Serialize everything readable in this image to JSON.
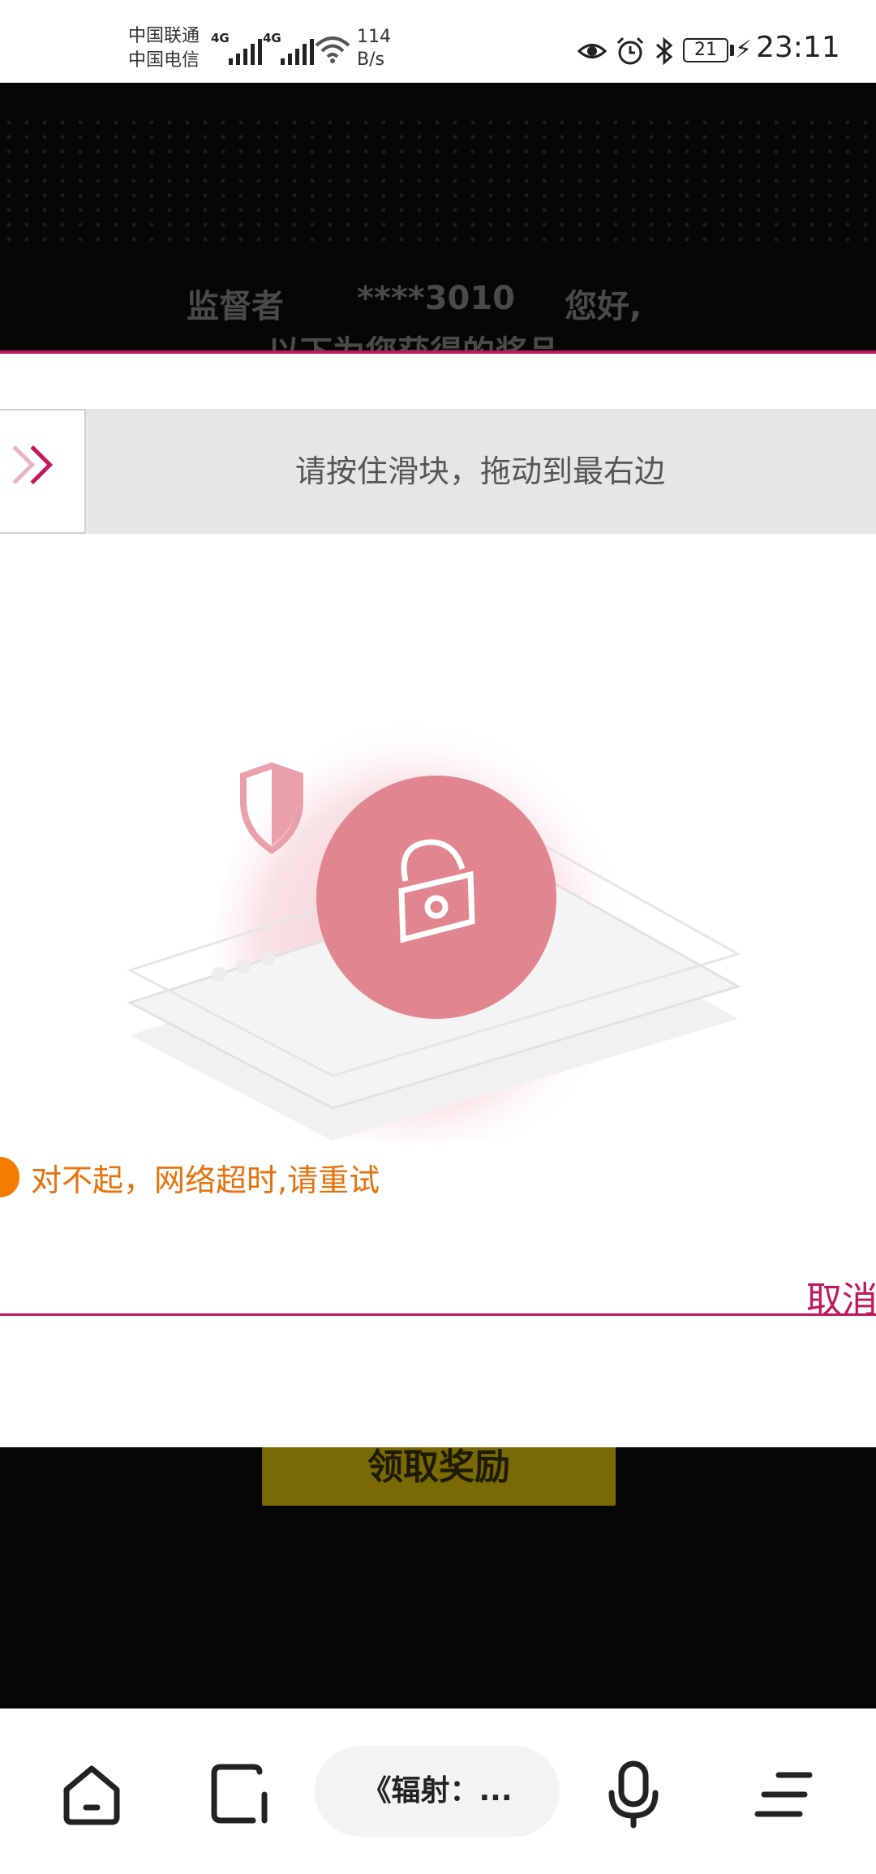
{
  "status_bar": {
    "carrier_1": "中国联通",
    "carrier_2": "中国电信",
    "network_1": "4G",
    "network_2": "4G",
    "net_speed_value": "114",
    "net_speed_unit": "B/s",
    "battery_level": "21",
    "time": "23:11",
    "icons": [
      "eye-icon",
      "alarm-icon",
      "bluetooth-icon",
      "battery-icon",
      "charging-icon",
      "wifi-icon",
      "signal-icon"
    ]
  },
  "background_page": {
    "greeting_role": "监督者",
    "greeting_account": "****3010",
    "greeting_hello": "您好,",
    "greeting_line2": "以下为您获得的奖品",
    "reward_button": "领取奖励"
  },
  "captcha": {
    "slider_hint": "请按住滑块，拖动到最右边",
    "error_message": "对不起，网络超时,请重试",
    "cancel_label": "取消",
    "accent_color": "#c2185b",
    "error_color": "#e8710a"
  },
  "browser_bar": {
    "page_title": "《辐射：...",
    "buttons": [
      "home-icon",
      "tabs-icon",
      "microphone-icon",
      "menu-icon"
    ]
  }
}
